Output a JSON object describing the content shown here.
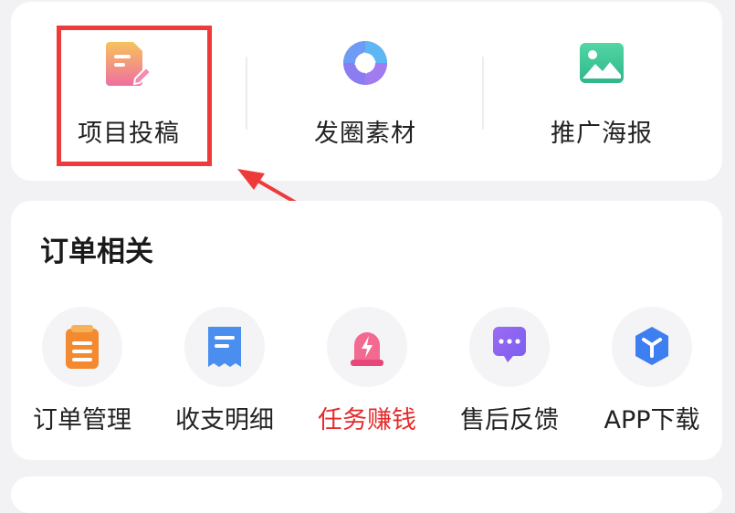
{
  "top_shortcuts": [
    {
      "label": "项目投稿",
      "icon": "edit-document-icon"
    },
    {
      "label": "发圈素材",
      "icon": "camera-aperture-icon"
    },
    {
      "label": "推广海报",
      "icon": "image-icon"
    }
  ],
  "order_section": {
    "title": "订单相关",
    "items": [
      {
        "label": "订单管理",
        "icon": "clipboard-list-icon"
      },
      {
        "label": "收支明细",
        "icon": "receipt-icon"
      },
      {
        "label": "任务赚钱",
        "icon": "alarm-light-icon",
        "highlight_color": "#e42b2b"
      },
      {
        "label": "售后反馈",
        "icon": "chat-bubble-icon"
      },
      {
        "label": "APP下载",
        "icon": "cube-download-icon"
      }
    ]
  },
  "colors": {
    "highlight_box": "#ee3a3a",
    "background": "#f2f2f4",
    "card": "#ffffff"
  }
}
